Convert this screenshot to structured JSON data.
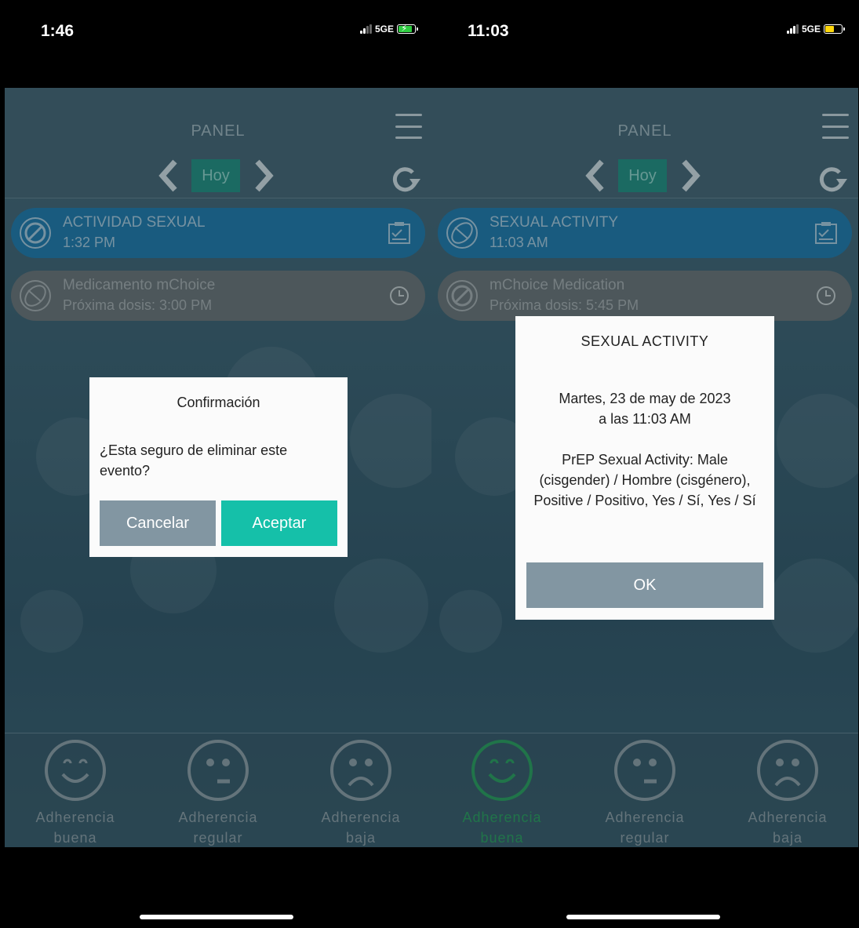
{
  "left": {
    "status": {
      "time": "1:46",
      "network": "5GE"
    },
    "header": {
      "title": "PANEL",
      "today_label": "Hoy"
    },
    "events": [
      {
        "title": "ACTIVIDAD SEXUAL",
        "subtitle": "1:32 PM",
        "icon": "prohibited-icon"
      },
      {
        "title": "Medicamento mChoice",
        "subtitle": "Próxima dosis: 3:00 PM",
        "icon": "pill-icon"
      }
    ],
    "adherence": [
      {
        "line1": "Adherencia",
        "line2": "buena",
        "icon": "smile-icon"
      },
      {
        "line1": "Adherencia",
        "line2": "regular",
        "icon": "neutral-face-icon"
      },
      {
        "line1": "Adherencia",
        "line2": "baja",
        "icon": "frown-icon"
      }
    ],
    "dialog": {
      "title": "Confirmación",
      "message": "¿Esta seguro de eliminar este evento?",
      "cancel": "Cancelar",
      "accept": "Aceptar"
    }
  },
  "right": {
    "status": {
      "time": "11:03",
      "network": "5GE"
    },
    "header": {
      "title": "PANEL",
      "today_label": "Hoy"
    },
    "events": [
      {
        "title": "SEXUAL ACTIVITY",
        "subtitle": "11:03 AM",
        "icon": "pill-icon"
      },
      {
        "title": "mChoice Medication",
        "subtitle": "Próxima dosis: 5:45 PM",
        "icon": "prohibited-icon"
      }
    ],
    "adherence": [
      {
        "line1": "Adherencia",
        "line2": "buena",
        "icon": "smile-icon",
        "active": true
      },
      {
        "line1": "Adherencia",
        "line2": "regular",
        "icon": "neutral-face-icon"
      },
      {
        "line1": "Adherencia",
        "line2": "baja",
        "icon": "frown-icon"
      }
    ],
    "dialog": {
      "title": "SEXUAL ACTIVITY",
      "date_line1": "Martes, 23 de may de 2023",
      "date_line2": "a las 11:03 AM",
      "detail": "PrEP Sexual Activity: Male (cisgender) / Hombre (cisgénero), Positive / Positivo, Yes / Sí, Yes / Sí",
      "ok": "OK"
    }
  },
  "colors": {
    "accent_teal": "#15c0a9",
    "hoy_green": "#1b8a7c",
    "event_blue": "#1873a8",
    "event_gray": "#676d70",
    "active_green": "#239a55"
  }
}
